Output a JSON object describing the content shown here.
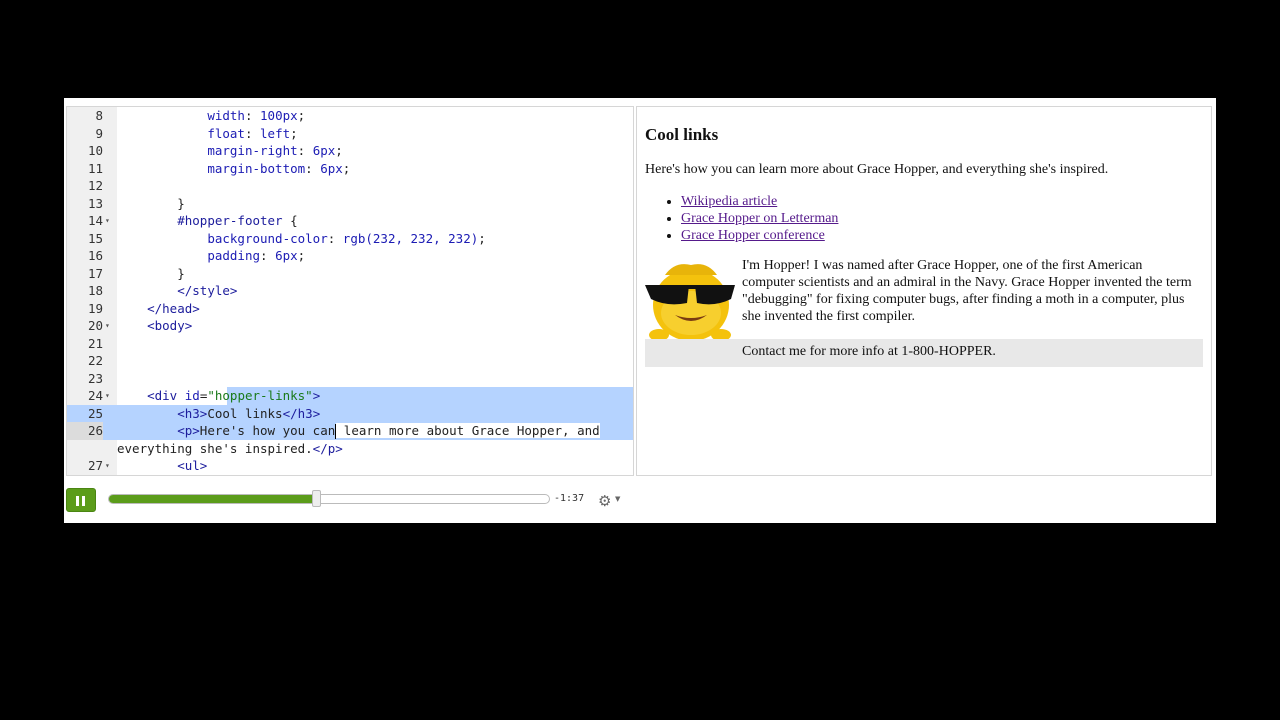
{
  "editor": {
    "lines": [
      {
        "num": "8",
        "fold": false,
        "html": "            <span class=\"k\">width</span>: <span class=\"v\">100px</span>;"
      },
      {
        "num": "9",
        "fold": false,
        "html": "            <span class=\"k\">float</span>: <span class=\"v\">left</span>;"
      },
      {
        "num": "10",
        "fold": false,
        "html": "            <span class=\"k\">margin-right</span>: <span class=\"v\">6px</span>;"
      },
      {
        "num": "11",
        "fold": false,
        "html": "            <span class=\"k\">margin-bottom</span>: <span class=\"v\">6px</span>;"
      },
      {
        "num": "12",
        "fold": false,
        "html": ""
      },
      {
        "num": "13",
        "fold": false,
        "html": "        }"
      },
      {
        "num": "14",
        "fold": true,
        "html": "        <span class=\"t\">#hopper-footer</span> {"
      },
      {
        "num": "15",
        "fold": false,
        "html": "            <span class=\"k\">background-color</span>: <span class=\"v\">rgb(232, 232, 232)</span>;"
      },
      {
        "num": "16",
        "fold": false,
        "html": "            <span class=\"k\">padding</span>: <span class=\"v\">6px</span>;"
      },
      {
        "num": "17",
        "fold": false,
        "html": "        }"
      },
      {
        "num": "18",
        "fold": false,
        "html": "        <span class=\"t\">&lt;/style&gt;</span>"
      },
      {
        "num": "19",
        "fold": false,
        "html": "    <span class=\"t\">&lt;/head&gt;</span>"
      },
      {
        "num": "20",
        "fold": true,
        "html": "    <span class=\"t\">&lt;body&gt;</span>"
      },
      {
        "num": "21",
        "fold": false,
        "html": ""
      },
      {
        "num": "22",
        "fold": false,
        "html": ""
      },
      {
        "num": "23",
        "fold": false,
        "html": ""
      },
      {
        "num": "24",
        "fold": true,
        "hl": "partial",
        "html": "    <span class=\"t\">&lt;div</span> <span class=\"k\">id</span>=<span class=\"s\">\"hopper-links\"</span><span class=\"t\">&gt;</span>"
      },
      {
        "num": "25",
        "fold": false,
        "hl": "full",
        "html": "        <span class=\"t\">&lt;h3&gt;</span>Cool links<span class=\"t\">&lt;/h3&gt;</span>"
      },
      {
        "num": "26",
        "fold": false,
        "hl": "caret",
        "current": true,
        "html": "        <span class=\"t\">&lt;p&gt;</span>Here's how you can"
      },
      {
        "num": "",
        "fold": false,
        "html": "everything she's inspired.<span class=\"t\">&lt;/p&gt;</span>",
        "wrap": true
      },
      {
        "num": "27",
        "fold": true,
        "html": "        <span class=\"t\">&lt;ul&gt;</span>"
      }
    ],
    "line26_rest": " learn more about Grace Hopper, and"
  },
  "preview": {
    "heading": "Cool links",
    "intro": "Here's how you can learn more about Grace Hopper, and everything she's inspired.",
    "links": [
      "Wikipedia article",
      "Grace Hopper on Letterman",
      "Grace Hopper conference"
    ],
    "bio": "I'm Hopper! I was named after Grace Hopper, one of the first American computer scientists and an admiral in the Navy. Grace Hopper invented the term \"debugging\" for fixing computer bugs, after finding a moth in a computer, plus she invented the first compiler.",
    "footer": "Contact me for more info at 1-800-HOPPER."
  },
  "player": {
    "progress": 0.47,
    "time_remaining": "-1:37",
    "gear_icon": "gear-icon",
    "play_icon": "pause-icon",
    "accent": "#5b9c1a"
  }
}
